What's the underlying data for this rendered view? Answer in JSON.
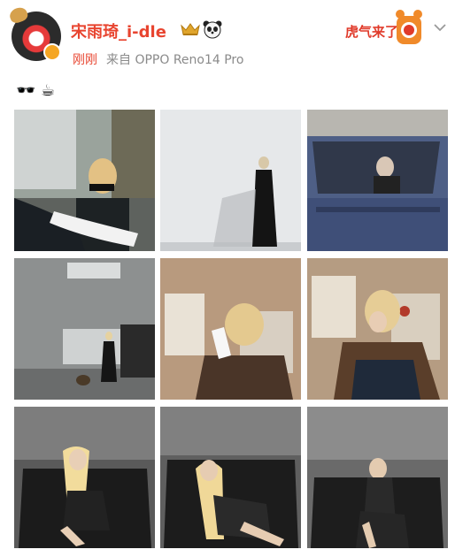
{
  "post": {
    "author": "宋雨琦_i-dle",
    "time": "刚刚",
    "source": "来自 OPPO Reno14 Pro",
    "content": "🕶️ ☕",
    "sticker_text": "虎气来了"
  },
  "icons": {
    "avatar": "avatar-image",
    "crown": "crown-icon",
    "panda": "panda-emoji-icon",
    "more": "chevron-down-icon"
  },
  "colors": {
    "name": "#e8442f",
    "time": "#e8442f",
    "source": "#8a8a8a"
  },
  "photos": [
    "street-portrait-sunglasses",
    "black-leather-outfit-white-wall",
    "person-in-car",
    "warehouse-walk-with-dog",
    "drinking-from-white-cup",
    "fur-jacket-portrait",
    "sitting-on-sofa-1",
    "sitting-on-sofa-2",
    "sitting-on-sofa-3"
  ]
}
